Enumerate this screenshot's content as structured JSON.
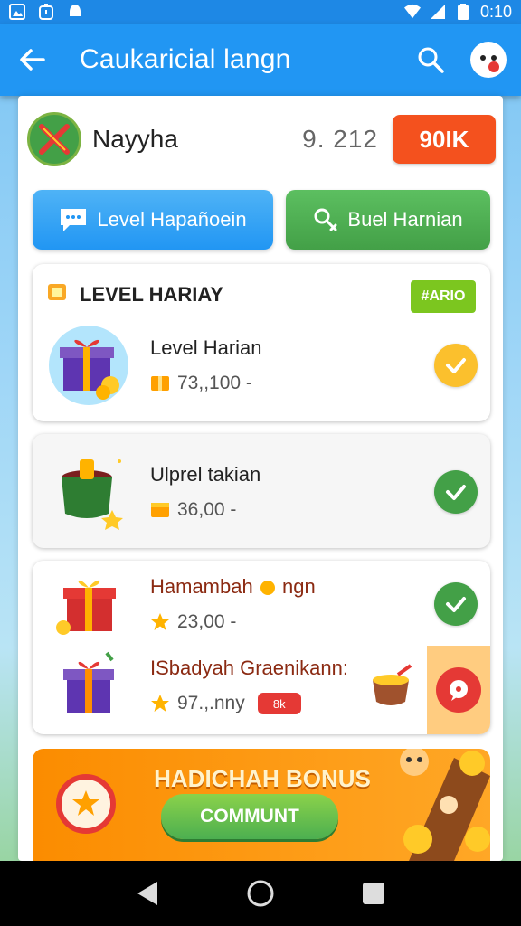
{
  "status_bar": {
    "time": "0:10",
    "icons": [
      "image-icon",
      "timer-icon",
      "notification-icon",
      "wifi-icon",
      "signal-icon",
      "battery-icon"
    ]
  },
  "app_bar": {
    "title": "Caukaricial langn",
    "color": "#2196f3",
    "icons": [
      "back-arrow-icon",
      "search-icon",
      "profile-avatar-icon"
    ]
  },
  "profile": {
    "name": "Nayyha",
    "score": "9. 212",
    "action_label": "90IK"
  },
  "tabs": [
    {
      "label": "Level Hapañoein",
      "icon": "chat-icon",
      "color": "#2196f3"
    },
    {
      "label": "Buel Harnian",
      "icon": "trophy-icon",
      "color": "#43a047"
    }
  ],
  "daily_section": {
    "title": "LEVEL HARIAY",
    "badge": "#ARIO",
    "tasks": [
      {
        "title": "Level Harian",
        "reward": "73,,100 -",
        "status": "completed",
        "art": "gift-box-icon"
      }
    ]
  },
  "task_two": {
    "title": "Ulprel takian",
    "reward": "36,00 -",
    "status": "completed",
    "art": "coin-pot-icon"
  },
  "bonus_tasks": [
    {
      "title": "Hamambah",
      "title_suffix": "ngn",
      "reward": "23,00 -",
      "status": "completed",
      "art": "red-gift-icon"
    },
    {
      "title": "ISbadyah Graenikann:",
      "reward": "97.,.nny",
      "chip": "8k",
      "art": "purple-gift-icon"
    }
  ],
  "bonus_banner": {
    "title": "HADICHAH BONUS",
    "button_label": "COMMUNT"
  },
  "nav_bar": {
    "icons": [
      "nav-back-icon",
      "nav-home-icon",
      "nav-recents-icon"
    ]
  },
  "colors": {
    "accent": "#2196f3",
    "success": "#43a047",
    "warning": "#fbc02d",
    "danger": "#f4511e",
    "bonus": "#fb8c00"
  }
}
